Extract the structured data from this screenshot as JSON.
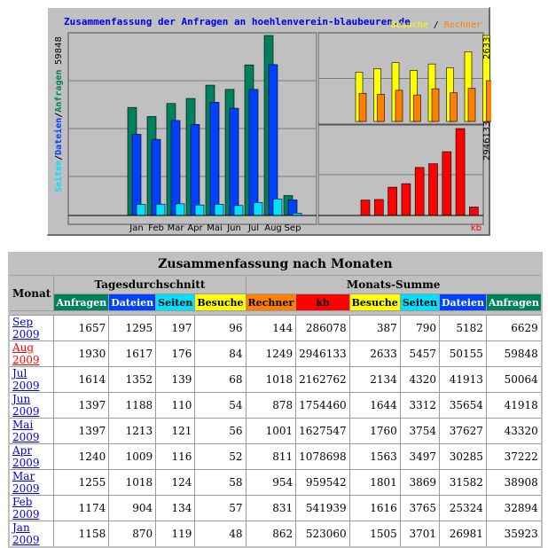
{
  "chart_data": [
    {
      "type": "bar",
      "title": "Zusammenfassung der Anfragen an hoehlenverein-blaubeuren.de",
      "categories": [
        "Jan",
        "Feb",
        "Mar",
        "Apr",
        "Mai",
        "Jun",
        "Jul",
        "Aug",
        "Sep"
      ],
      "ylabel_parts": [
        "Seiten",
        "Dateien",
        "Anfragen"
      ],
      "ymax_label": "59848",
      "ylim": [
        0,
        59848
      ],
      "series": [
        {
          "name": "Anfragen",
          "color": "#00805c",
          "values": [
            35923,
            32894,
            37222,
            38908,
            43320,
            41918,
            50064,
            59848,
            6629
          ]
        },
        {
          "name": "Dateien",
          "color": "#0040ff",
          "values": [
            26981,
            25324,
            31582,
            30285,
            37627,
            35654,
            41913,
            50155,
            5182
          ]
        },
        {
          "name": "Seiten",
          "color": "#00e0ff",
          "values": [
            3701,
            3765,
            3869,
            3497,
            3754,
            3312,
            4320,
            5457,
            790
          ]
        }
      ]
    },
    {
      "type": "bar",
      "title": "",
      "legend_parts": [
        "Besuche",
        "Rechner"
      ],
      "ymax_label": "2633",
      "ylim": [
        0,
        2633
      ],
      "series": [
        {
          "name": "Besuche",
          "color": "#ffff00",
          "values": [
            1505,
            1616,
            1801,
            1563,
            1760,
            1644,
            2134,
            2633,
            387
          ]
        },
        {
          "name": "Rechner",
          "color": "#ff8000",
          "values": [
            862,
            831,
            954,
            811,
            1001,
            878,
            1018,
            1249,
            144
          ]
        }
      ]
    },
    {
      "type": "bar",
      "title": "",
      "unit_label": "kb",
      "ymax_label": "2946133",
      "ylim": [
        0,
        2946133
      ],
      "series": [
        {
          "name": "kb",
          "color": "#ff0000",
          "values": [
            523060,
            541939,
            959542,
            1078698,
            1627547,
            1754460,
            2162762,
            2946133,
            286078
          ]
        }
      ]
    }
  ],
  "table": {
    "caption": "Zusammenfassung nach Monaten",
    "monat_header": "Monat",
    "group_daily": "Tagesdurchschnitt",
    "group_monthly": "Monats-Summe",
    "columns": [
      {
        "label": "Anfragen",
        "color": "#00805c",
        "text": "#ffffff"
      },
      {
        "label": "Dateien",
        "color": "#0040ff",
        "text": "#ffffff"
      },
      {
        "label": "Seiten",
        "color": "#00e0ff",
        "text": "#000000"
      },
      {
        "label": "Besuche",
        "color": "#ffff00",
        "text": "#000000"
      },
      {
        "label": "Rechner",
        "color": "#ff8000",
        "text": "#000000"
      },
      {
        "label": "kb",
        "color": "#ff0000",
        "text": "#000000"
      },
      {
        "label": "Besuche",
        "color": "#ffff00",
        "text": "#000000"
      },
      {
        "label": "Seiten",
        "color": "#00e0ff",
        "text": "#000000"
      },
      {
        "label": "Dateien",
        "color": "#0040ff",
        "text": "#ffffff"
      },
      {
        "label": "Anfragen",
        "color": "#00805c",
        "text": "#ffffff"
      }
    ],
    "rows": [
      {
        "month": "Sep 2009",
        "current": false,
        "cells": [
          "1657",
          "1295",
          "197",
          "96",
          "144",
          "286078",
          "387",
          "790",
          "5182",
          "6629"
        ]
      },
      {
        "month": "Aug 2009",
        "current": true,
        "cells": [
          "1930",
          "1617",
          "176",
          "84",
          "1249",
          "2946133",
          "2633",
          "5457",
          "50155",
          "59848"
        ]
      },
      {
        "month": "Jul 2009",
        "current": false,
        "cells": [
          "1614",
          "1352",
          "139",
          "68",
          "1018",
          "2162762",
          "2134",
          "4320",
          "41913",
          "50064"
        ]
      },
      {
        "month": "Jun 2009",
        "current": false,
        "cells": [
          "1397",
          "1188",
          "110",
          "54",
          "878",
          "1754460",
          "1644",
          "3312",
          "35654",
          "41918"
        ]
      },
      {
        "month": "Mai 2009",
        "current": false,
        "cells": [
          "1397",
          "1213",
          "121",
          "56",
          "1001",
          "1627547",
          "1760",
          "3754",
          "37627",
          "43320"
        ]
      },
      {
        "month": "Apr 2009",
        "current": false,
        "cells": [
          "1240",
          "1009",
          "116",
          "52",
          "811",
          "1078698",
          "1563",
          "3497",
          "30285",
          "37222"
        ]
      },
      {
        "month": "Mar 2009",
        "current": false,
        "cells": [
          "1255",
          "1018",
          "124",
          "58",
          "954",
          "959542",
          "1801",
          "3869",
          "31582",
          "38908"
        ]
      },
      {
        "month": "Feb 2009",
        "current": false,
        "cells": [
          "1174",
          "904",
          "134",
          "57",
          "831",
          "541939",
          "1616",
          "3765",
          "25324",
          "32894"
        ]
      },
      {
        "month": "Jan 2009",
        "current": false,
        "cells": [
          "1158",
          "870",
          "119",
          "48",
          "862",
          "523060",
          "1505",
          "3701",
          "26981",
          "35923"
        ]
      }
    ]
  }
}
